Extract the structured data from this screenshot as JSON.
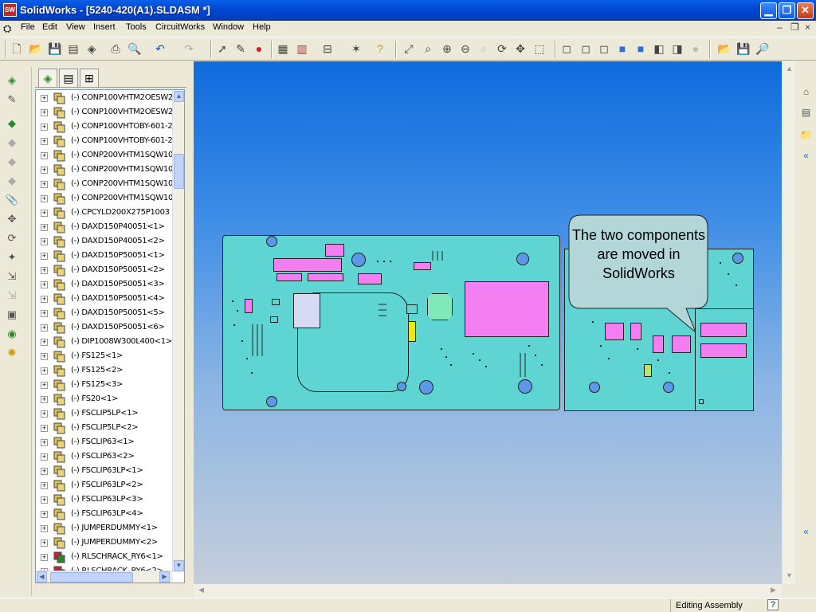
{
  "window": {
    "title": "SolidWorks - [5240-420(A1).SLDASM *]",
    "app_icon_text": "SW"
  },
  "menu": [
    "File",
    "Edit",
    "View",
    "Insert",
    "Tools",
    "CircuitWorks",
    "Window",
    "Help"
  ],
  "tree": {
    "items": [
      "(-) CONP100VHTM2OESW2",
      "(-) CONP100VHTM2OESW2",
      "(-) CONP100VHTOBY-601-2",
      "(-) CONP100VHTOBY-601-2",
      "(-) CONP200VHTM1SQW10",
      "(-) CONP200VHTM1SQW10",
      "(-) CONP200VHTM1SQW10",
      "(-) CONP200VHTM1SQW10",
      "(-) CPCYLD200X275P1003",
      "(-) DAXD150P40051<1>",
      "(-) DAXD150P40051<2>",
      "(-) DAXD150P50051<1>",
      "(-) DAXD150P50051<2>",
      "(-) DAXD150P50051<3>",
      "(-) DAXD150P50051<4>",
      "(-) DAXD150P50051<5>",
      "(-) DAXD150P50051<6>",
      "(-) DIP1008W300L400<1>",
      "(-) FS125<1>",
      "(-) FS125<2>",
      "(-) FS125<3>",
      "(-) FS20<1>",
      "(-) FSCLIP5LP<1>",
      "(-) FSCLIP5LP<2>",
      "(-) FSCLIP63<1>",
      "(-) FSCLIP63<2>",
      "(-) FSCLIP63LP<1>",
      "(-) FSCLIP63LP<2>",
      "(-) FSCLIP63LP<3>",
      "(-) FSCLIP63LP<4>",
      "(-) JUMPERDUMMY<1>",
      "(-) JUMPERDUMMY<2>",
      "(-) RLSCHRACK_RY6<1>",
      "(-) RLSCHRACK_RY6<2>"
    ]
  },
  "callout": {
    "text": "The two components are moved in SolidWorks"
  },
  "status": {
    "text": "Editing Assembly"
  },
  "colors": {
    "board": "#5ed5d3",
    "part": "#f27ef2",
    "viewport_top": "#0f6bdc",
    "viewport_bottom": "#c5cedb"
  }
}
